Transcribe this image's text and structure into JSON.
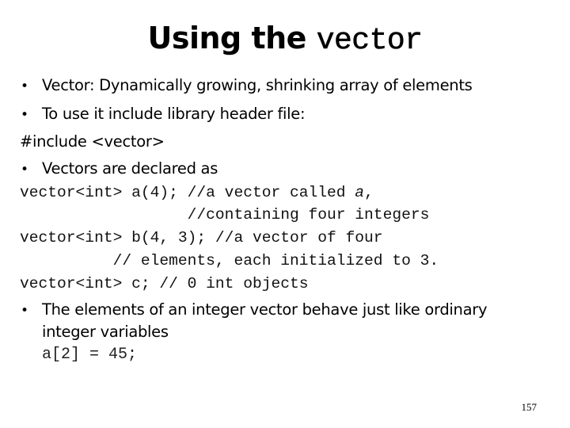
{
  "slide": {
    "title_prefix": "Using the ",
    "title_code": "vector",
    "bullets_top": [
      {
        "bullet": "•",
        "text": "Vector: Dynamically growing, shrinking array of elements"
      },
      {
        "bullet": "•",
        "text": "To use it include library header file:"
      }
    ],
    "include_line": "#include <vector>",
    "bullet_declared": {
      "bullet": "•",
      "text": "Vectors are declared as"
    },
    "code_lines": {
      "line1_pre": "vector<int> a(4); //a vector called ",
      "line1_italic": "a",
      "line1_post": ",",
      "line2": "                  //containing four integers",
      "line3": "vector<int> b(4, 3); //a vector of four",
      "line4": "          // elements, each initialized to 3.",
      "line5": "vector<int> c; // 0 int objects"
    },
    "bullet_bottom": {
      "bullet": "•",
      "text_line1": "The elements of an integer vector behave just like ordinary",
      "text_line2": "integer variables",
      "code": "a[2] = 45;"
    },
    "page_number": "157"
  }
}
